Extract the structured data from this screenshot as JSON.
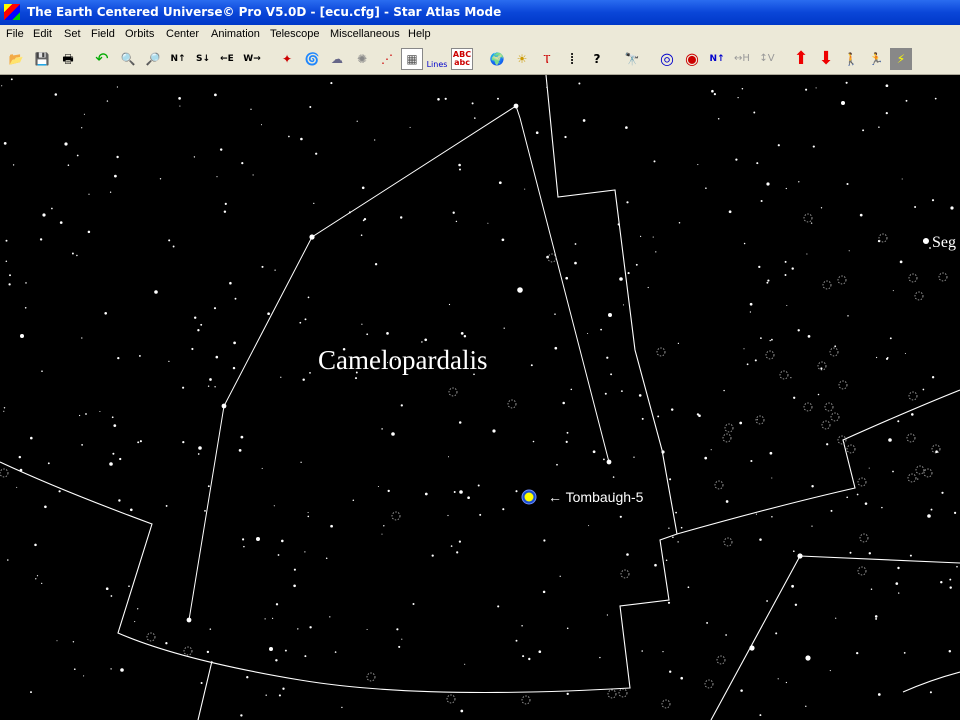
{
  "window": {
    "title": "The Earth Centered Universe© Pro V5.0D - [ecu.cfg] - Star Atlas Mode"
  },
  "menu": {
    "items": [
      "File",
      "Edit",
      "Set",
      "Field",
      "Orbits",
      "Center",
      "Animation",
      "Telescope",
      "Miscellaneous",
      "Help"
    ]
  },
  "toolbar": {
    "buttons": [
      {
        "name": "open-file-icon",
        "glyph": "📂"
      },
      {
        "name": "save-icon",
        "glyph": "💾"
      },
      {
        "name": "print-icon",
        "glyph": "🖶"
      },
      {
        "name": "undo-icon",
        "glyph": "↶"
      },
      {
        "name": "zoom-out-icon",
        "glyph": "🔍"
      },
      {
        "name": "zoom-in-icon",
        "glyph": "🔎"
      },
      {
        "name": "north-arrow-icon",
        "glyph": "N↑"
      },
      {
        "name": "south-arrow-icon",
        "glyph": "S↓"
      },
      {
        "name": "east-arrow-icon",
        "glyph": "←E"
      },
      {
        "name": "west-arrow-icon",
        "glyph": "W→"
      },
      {
        "name": "stars-icon",
        "glyph": "✦"
      },
      {
        "name": "galaxy-icon",
        "glyph": "🌀"
      },
      {
        "name": "milky-way-icon",
        "glyph": "☁"
      },
      {
        "name": "deep-sky-icon",
        "glyph": "✺"
      },
      {
        "name": "constellation-icon",
        "glyph": "⋰"
      },
      {
        "name": "grid-icon",
        "glyph": "▦"
      },
      {
        "name": "constellation-lines-icon",
        "glyph": "Lines"
      },
      {
        "name": "labels-icon",
        "glyph": "ABC abc"
      },
      {
        "name": "earth-icon",
        "glyph": "🌍"
      },
      {
        "name": "sun-icon",
        "glyph": "☀"
      },
      {
        "name": "ecliptic-icon",
        "glyph": "Ⲧ"
      },
      {
        "name": "dots-icon",
        "glyph": "⁞"
      },
      {
        "name": "find-object-icon",
        "glyph": "?"
      },
      {
        "name": "telescope-icon",
        "glyph": "🔭"
      },
      {
        "name": "target-icon",
        "glyph": "◎"
      },
      {
        "name": "crosshair-target-icon",
        "glyph": "◉"
      },
      {
        "name": "north-up-icon",
        "glyph": "N↑"
      },
      {
        "name": "flip-horizontal-icon",
        "glyph": "↔H"
      },
      {
        "name": "flip-vertical-icon",
        "glyph": "↕V"
      },
      {
        "name": "up-arrow-icon",
        "glyph": "⬆"
      },
      {
        "name": "down-arrow-icon",
        "glyph": "⬇"
      },
      {
        "name": "walking-man-icon",
        "glyph": "🚶"
      },
      {
        "name": "running-man-icon",
        "glyph": "🏃"
      },
      {
        "name": "lightning-icon",
        "glyph": "⚡"
      }
    ]
  },
  "sky": {
    "constellation_label": "Camelopardalis",
    "object_label": "← Tombaugh-5",
    "edge_label": "Seg",
    "colors": {
      "background": "#000000",
      "lines": "#ffffff",
      "object": "#ffff00",
      "object_ring": "#2a6cff"
    }
  }
}
